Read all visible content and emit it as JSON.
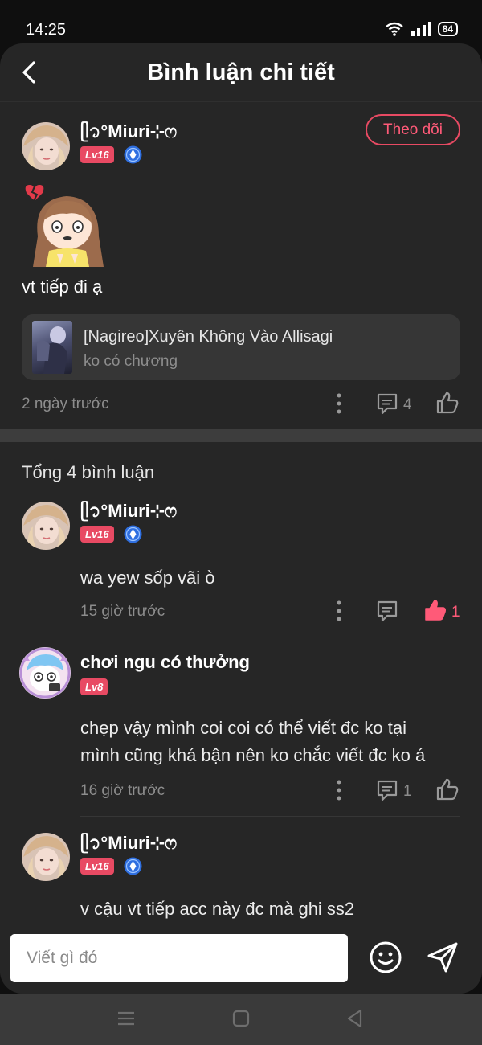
{
  "status": {
    "time": "14:25",
    "battery": "84"
  },
  "header": {
    "title": "Bình luận chi tiết"
  },
  "post": {
    "username": "ᥫ᭡°Miuri⊹ෆ",
    "level": "Lv16",
    "follow_label": "Theo dõi",
    "text": "vt tiếp đi ạ",
    "story": {
      "title": "[Nagireo]Xuyên Không Vào Allisagi",
      "subtitle": "ko có chương"
    },
    "time": "2 ngày trước",
    "reply_count": "4"
  },
  "comments_total": "Tổng 4 bình luận",
  "comments": [
    {
      "username": "ᥫ᭡°Miuri⊹ෆ",
      "level": "Lv16",
      "text": "wa yew sốp vãi ò",
      "time": "15 giờ trước",
      "like_count": "1"
    },
    {
      "username": "chơi ngu có thưởng",
      "level": "Lv8",
      "text_line1": "chẹp vậy mình coi coi có thể viết đc ko tại",
      "text_line2": "mình cũng khá bận nên ko chắc viết đc ko á",
      "time": "16 giờ trước",
      "reply_count": "1"
    },
    {
      "username": "ᥫ᭡°Miuri⊹ෆ",
      "level": "Lv16",
      "text": "v cậu vt tiếp acc này đc mà ghi ss2"
    }
  ],
  "input": {
    "placeholder": "Viết gì đó"
  },
  "colors": {
    "accent": "#e84a63",
    "sheet": "#262626",
    "muted": "#8d8d8d"
  }
}
